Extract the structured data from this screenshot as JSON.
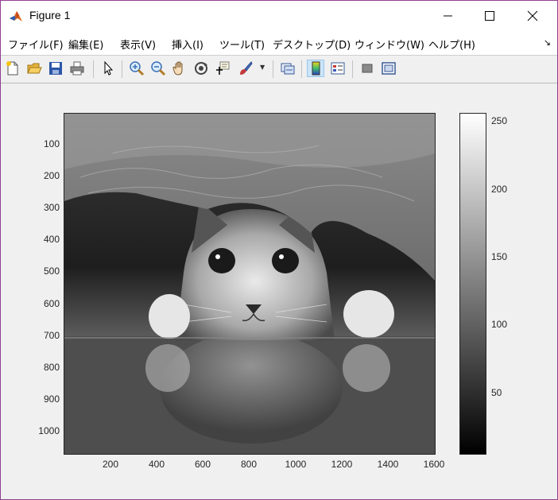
{
  "window": {
    "title": "Figure 1",
    "controls": {
      "minimize": "minimize",
      "maximize": "maximize",
      "close": "close"
    }
  },
  "menu": {
    "items": [
      {
        "label": "ファイル(F)"
      },
      {
        "label": "編集(E)"
      },
      {
        "label": "表示(V)"
      },
      {
        "label": "挿入(I)"
      },
      {
        "label": "ツール(T)"
      },
      {
        "label": "デスクトップ(D)"
      },
      {
        "label": "ウィンドウ(W)"
      },
      {
        "label": "ヘルプ(H)"
      }
    ],
    "dock_arrow": "↘"
  },
  "toolbar": {
    "buttons": [
      {
        "icon": "new-figure-icon"
      },
      {
        "icon": "open-file-icon"
      },
      {
        "icon": "save-icon"
      },
      {
        "icon": "print-icon"
      },
      {
        "icon": "edit-plot-icon"
      },
      {
        "icon": "zoom-in-icon"
      },
      {
        "icon": "zoom-out-icon"
      },
      {
        "icon": "pan-icon"
      },
      {
        "icon": "rotate-3d-icon"
      },
      {
        "icon": "data-cursor-icon"
      },
      {
        "icon": "brush-icon"
      },
      {
        "icon": "link-plot-icon"
      },
      {
        "icon": "insert-colorbar-icon",
        "active": true
      },
      {
        "icon": "insert-legend-icon"
      },
      {
        "icon": "hide-plot-tools-icon"
      },
      {
        "icon": "show-plot-tools-icon"
      }
    ]
  },
  "image_axes": {
    "content": "grayscale photo of a kitten peeking out from under a knitted blanket",
    "y_ticks": [
      "100",
      "200",
      "300",
      "400",
      "500",
      "600",
      "700",
      "800",
      "900",
      "1000"
    ],
    "x_ticks": [
      "200",
      "400",
      "600",
      "800",
      "1000",
      "1200",
      "1400",
      "1600"
    ],
    "x_range": [
      0,
      1600
    ],
    "y_range": [
      0,
      1060
    ]
  },
  "colorbar": {
    "colormap": "gray",
    "range": [
      0,
      255
    ],
    "ticks": [
      "250",
      "200",
      "150",
      "100",
      "50"
    ],
    "tick_values": [
      250,
      200,
      150,
      100,
      50
    ],
    "low_color": "#000000",
    "high_color": "#ffffff"
  }
}
